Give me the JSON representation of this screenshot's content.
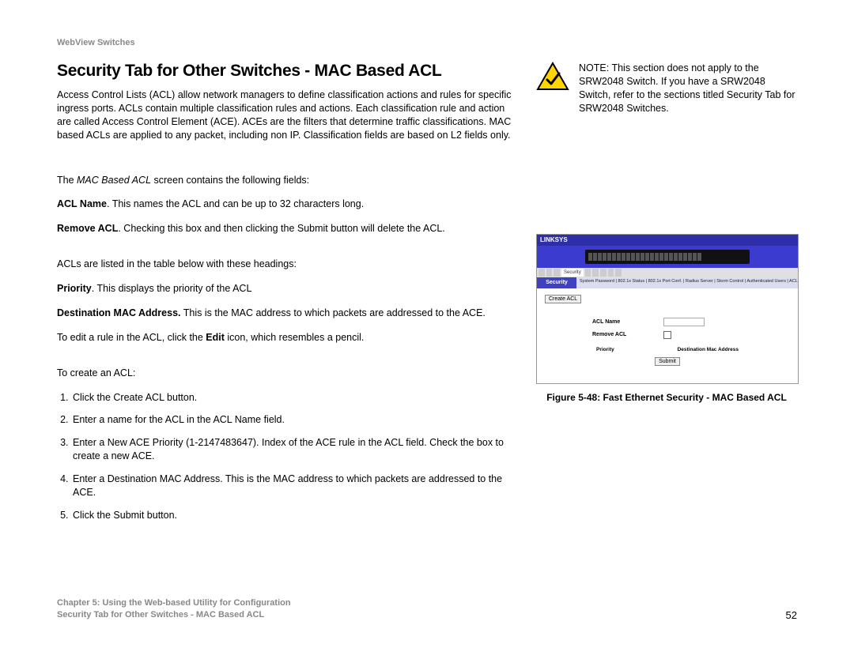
{
  "header": {
    "product": "WebView Switches"
  },
  "section": {
    "title": "Security Tab for Other Switches - MAC Based ACL"
  },
  "note": {
    "label": "NOTE:",
    "text": " This section does not apply to the SRW2048 Switch. If you have a SRW2048 Switch, refer to the sections titled Security Tab for SRW2048 Switches."
  },
  "intro": "Access Control Lists (ACL) allow network managers to define classification actions and rules for specific ingress ports. ACLs contain multiple classification rules and actions. Each classification rule and action are called Access Control Element (ACE). ACEs are the filters that determine traffic classifications. MAC based ACLs are applied to any packet, including non IP. Classification fields are based on L2 fields only.",
  "fields_intro_pre": "The ",
  "fields_intro_italic": "MAC Based ACL",
  "fields_intro_post": " screen contains the following fields:",
  "acl_name_label": "ACL Name",
  "acl_name_text": ". This names the ACL and can be up to 32 characters long.",
  "remove_label": "Remove ACL",
  "remove_text": ". Checking this box and then clicking the Submit button will delete the ACL.",
  "table_intro": "ACLs are listed in the table below with these headings:",
  "priority_label": "Priority",
  "priority_text": ". This displays the priority of the ACL",
  "dest_label": "Destination MAC Address.",
  "dest_text": " This is the MAC address to which packets are addressed to the ACE.",
  "edit_pre": "To edit a rule in the ACL, click the ",
  "edit_bold": "Edit",
  "edit_post": " icon, which resembles a pencil.",
  "create_intro": "To create an ACL:",
  "steps": {
    "s1_pre": "Click the ",
    "s1_bold": "Create ACL",
    "s1_post": " button.",
    "s2_pre": "Enter a name for the ACL in the ",
    "s2_bold": "ACL Name",
    "s2_post": " field.",
    "s3": "Enter a New ACE Priority (1-2147483647). Index of the ACE rule in the ACL field. Check the box to create a new ACE.",
    "s4": "Enter a Destination MAC Address. This is the MAC address to which packets are addressed to the ACE.",
    "s5_pre": "Click the ",
    "s5_bold": "Submit",
    "s5_post": " button."
  },
  "figure": {
    "brand": "LINKSYS",
    "sidebar_label": "Security",
    "subtabs": "System Password | 802.1x Status | 802.1x Port Conf. | Radius Server | Storm Control | Authenticated Users | ACL | MAC Based ACL | ACL Binding |",
    "create_btn": "Create ACL",
    "row1_label": "ACL Name",
    "row2_label": "Remove ACL",
    "col1": "Priority",
    "col2": "Destination Mac Address",
    "submit": "Submit",
    "caption": "Figure 5-48: Fast Ethernet Security - MAC Based ACL"
  },
  "footer": {
    "chapter": "Chapter 5: Using the Web-based Utility for Configuration",
    "subtitle": "Security Tab for Other Switches - MAC Based ACL",
    "page": "52"
  }
}
